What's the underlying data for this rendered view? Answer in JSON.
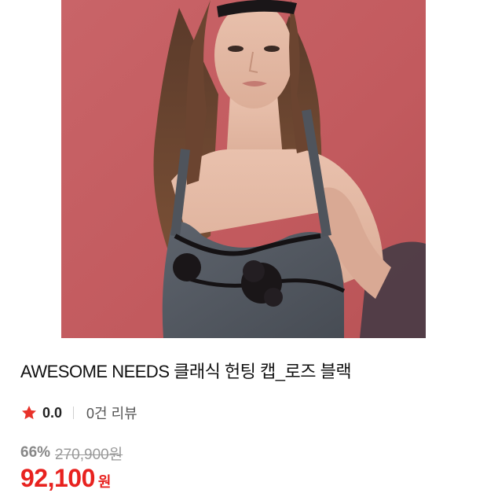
{
  "product": {
    "image_alt": "AWESOME NEEDS 클래식 헌팅 캡_로즈 블랙 model photo",
    "title": "AWESOME NEEDS 클래식 헌팅 캡_로즈 블랙",
    "rating": {
      "score": "0.0",
      "review_count_label": "0건 리뷰",
      "star_icon": "star-icon",
      "star_color": "#e8322a"
    },
    "pricing": {
      "discount_rate": "66%",
      "original_price": "270,900원",
      "sale_price": "92,100",
      "currency": "원",
      "sale_color": "#e8221f"
    }
  }
}
